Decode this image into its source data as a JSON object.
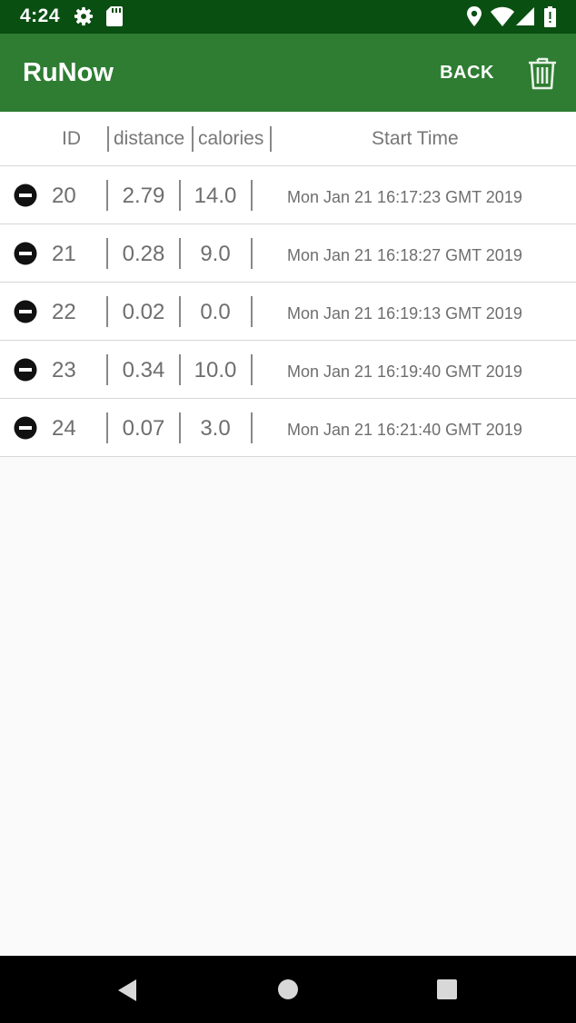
{
  "status_bar": {
    "time": "4:24"
  },
  "app_bar": {
    "title": "RuNow",
    "back_label": "BACK"
  },
  "table": {
    "headers": {
      "id": "ID",
      "distance": "distance",
      "calories": "calories",
      "start_time": "Start Time"
    },
    "rows": [
      {
        "id": "20",
        "distance": "2.79",
        "calories": "14.0",
        "start_time": "Mon Jan 21 16:17:23 GMT 2019"
      },
      {
        "id": "21",
        "distance": "0.28",
        "calories": "9.0",
        "start_time": "Mon Jan 21 16:18:27 GMT 2019"
      },
      {
        "id": "22",
        "distance": "0.02",
        "calories": "0.0",
        "start_time": "Mon Jan 21 16:19:13 GMT 2019"
      },
      {
        "id": "23",
        "distance": "0.34",
        "calories": "10.0",
        "start_time": "Mon Jan 21 16:19:40 GMT 2019"
      },
      {
        "id": "24",
        "distance": "0.07",
        "calories": "3.0",
        "start_time": "Mon Jan 21 16:21:40 GMT 2019"
      }
    ]
  },
  "colors": {
    "status_bar": "#0a4f12",
    "app_bar": "#2e7d32",
    "background": "#fafafa"
  },
  "icons": [
    "settings-icon",
    "sd-card-icon",
    "location-icon",
    "wifi-icon",
    "signal-icon",
    "battery-icon",
    "trash-icon",
    "remove-icon",
    "nav-back-icon",
    "nav-home-icon",
    "nav-recents-icon"
  ]
}
